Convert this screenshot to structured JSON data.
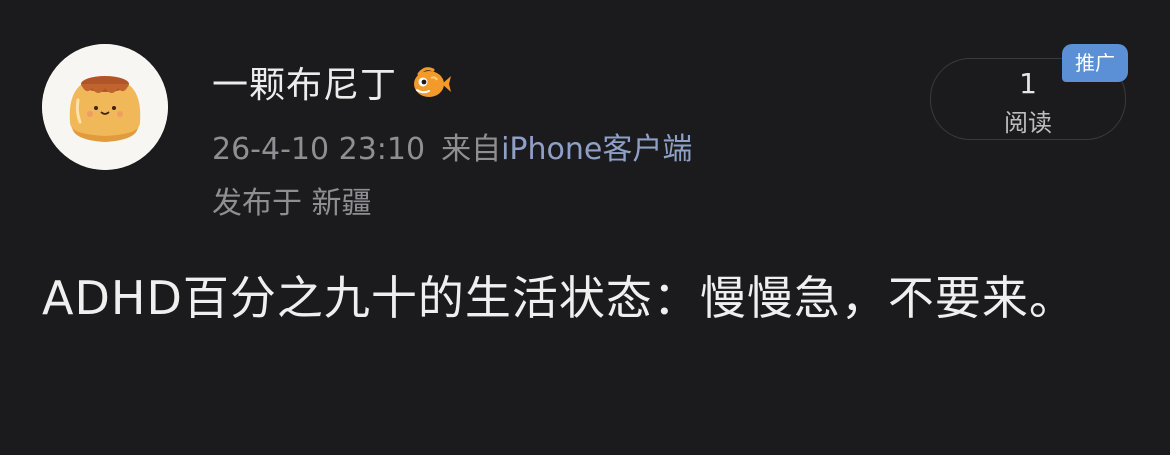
{
  "post": {
    "username": "一颗布尼丁",
    "timestamp": "26-4-10 23:10",
    "from_label": "来自",
    "source": "iPhone客户端",
    "location": "发布于 新疆",
    "read_count": "1",
    "read_label": "阅读",
    "promo_tag": "推广",
    "content": "ADHD百分之九十的生活状态：慢慢急，不要来。"
  },
  "icons": {
    "avatar": "pudding-avatar",
    "badge": "fish-badge-icon"
  },
  "colors": {
    "background": "#1b1a1c",
    "text_primary": "#ececec",
    "text_secondary": "#8e8e93",
    "source_link": "#8fa0c6",
    "promo_tag_bg": "#5b8fd6",
    "badge_orange": "#f39a2b"
  }
}
